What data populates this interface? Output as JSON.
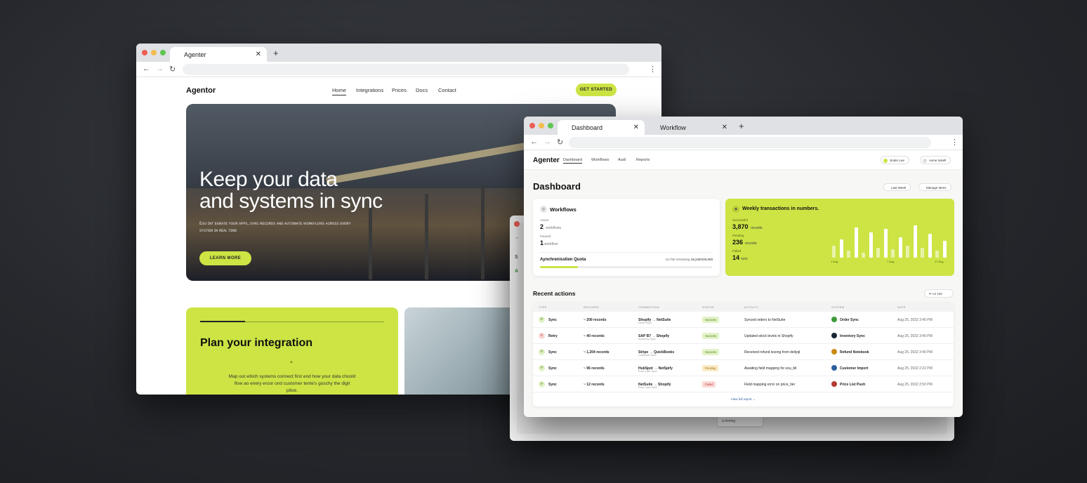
{
  "colors": {
    "accent_lime": "#cde444",
    "success_bg": "#e2f3c7",
    "success_fg": "#4f7a16",
    "pending_bg": "#fbebc4",
    "pending_fg": "#9a6a10",
    "failed_bg": "#fbd9d6",
    "failed_fg": "#b23a31"
  },
  "site_window": {
    "tab_title": "Agenter",
    "logo": "Agentor",
    "nav": [
      "Home",
      "Integrations",
      "Prices",
      "Docs",
      "Contact"
    ],
    "cta": "GET STARTED",
    "hero": {
      "title_line1": "Keep your data",
      "title_line2": "and systems in sync",
      "subtitle": "Ꮛxᴜ ɪɴᴛ ᴇɢʀᴀᴛᴇ ʏᴏᴜʀ ᴀᴘᴘꜱ, ꜱʏɴᴄ ʀᴇᴄᴏʀᴅꜱ ᴀɴᴅ ᴀᴜᴛᴏᴍᴀᴛᴇ ᴡᴏʀᴋꜰʟᴏᴡꜱ ᴀᴄʀᴏꜱꜱ ᴇᴠᴇʀʏ ꜱʏꜱᴛᴇᴍ ɪɴ ʀᴇᴀʟ ᴛɪᴍᴇ",
      "button": "LEARN MORE"
    },
    "plan_card": {
      "title": "Plan your integration",
      "body": "Map out which systems connect first end how your data choold flow ao enery eroor ond customer tente's goschy the digit pitoe."
    }
  },
  "back_window": {
    "fragment_1": "S",
    "fragment_2": "A",
    "bubble": "a mming"
  },
  "dashboard_window": {
    "tabs": [
      {
        "label": "Dashboard"
      },
      {
        "label": "Workflow"
      }
    ],
    "logo": "Agenter",
    "nav": [
      "Dashboard",
      "Workflows",
      "Audi",
      "Reports"
    ],
    "user_pill": "Jinder Lee",
    "account_pill": "Avme Notell",
    "title": "Dashboard",
    "btn_last_week": "Last Week",
    "btn_manage": "Manage Items",
    "workflows": {
      "title": "Workflows",
      "active_label": "Active",
      "active_value": "2",
      "active_unit": "workflows",
      "paused_label": "Paused",
      "paused_value": "1",
      "paused_unit": "workflow",
      "quota_label": "Aynchrenisstien Quota",
      "quota_meta_prefix": "10,750 remaining",
      "quota_meta_value": "16,240/100,000",
      "quota_fraction": 0.22
    },
    "weekly": {
      "title": "Weekly transactions in numbers.",
      "stats": [
        {
          "label": "Successful",
          "value": "3,870",
          "unit": "records"
        },
        {
          "label": "Pending",
          "value": "236",
          "unit": "records"
        },
        {
          "label": "Failed",
          "value": "14",
          "unit": "runs"
        }
      ],
      "chart_data": {
        "type": "bar",
        "series": [
          {
            "values": [
              0.35,
              0.55,
              0.2,
              0.9,
              0.15,
              0.75,
              0.3,
              0.85,
              0.25,
              0.6,
              0.35,
              0.95,
              0.3,
              0.7,
              0.2,
              0.5
            ]
          }
        ],
        "tick_labels": [
          "1 Aug",
          "7 Aug",
          "17 Aug"
        ]
      }
    },
    "recent": {
      "title": "Recent actions",
      "filter": "A2 100",
      "columns": [
        "TYPE",
        "RECORDS",
        "CONNECTION",
        "STATUS",
        "ACTIVITY",
        "SYSTEM",
        "DATE"
      ],
      "rows": [
        {
          "type": "Sync",
          "records": "~ 200 records",
          "conn": "Shopify → NetSuite",
          "conn_sub": "Order Sync",
          "status": "Success",
          "activity": "Synced orders to NetSuite",
          "system": "Order Sync",
          "sys_color": "#3f9a3a",
          "date": "Aug 25, 2032 3:40 PM"
        },
        {
          "type": "Retry",
          "records": "~ 40 records",
          "conn": "SAP B7 → Shopify",
          "conn_sub": "Inventory Sync",
          "status": "Success",
          "activity": "Updated stock levels in Shopify",
          "system": "Inventory Sync",
          "sys_color": "#1a2533",
          "date": "Aug 25, 2032 3:40 PM"
        },
        {
          "type": "Sync",
          "records": "~ 1,204 records",
          "conn": "Stripe → QuickBooks",
          "conn_sub": "Customer Sync",
          "status": "Success",
          "activity": "Received refund issong from deliyql",
          "system": "Refund Notebook",
          "sys_color": "#c98a14",
          "date": "Aug 25, 2032 3:40 PM"
        },
        {
          "type": "Sync",
          "records": "~ 96 records",
          "conn": "HubSpot → NetSpify",
          "conn_sub": "Price Lists Sync",
          "status": "Pending",
          "activity": "Awaiting field mapping for sou_bil",
          "system": "Customer Import",
          "sys_color": "#2c5f9e",
          "date": "Aug 25, 2032 2:22 PM"
        },
        {
          "type": "Sync",
          "records": "~ 12 records",
          "conn": "NetSuite → Shopify",
          "conn_sub": "Price Lists Sync",
          "status": "Failed",
          "activity": "Field mapping error on price_tier",
          "system": "Price List Push",
          "sys_color": "#b23a31",
          "date": "Aug 25, 2032 2:50 PM"
        }
      ],
      "view_full": "View full report →"
    }
  }
}
